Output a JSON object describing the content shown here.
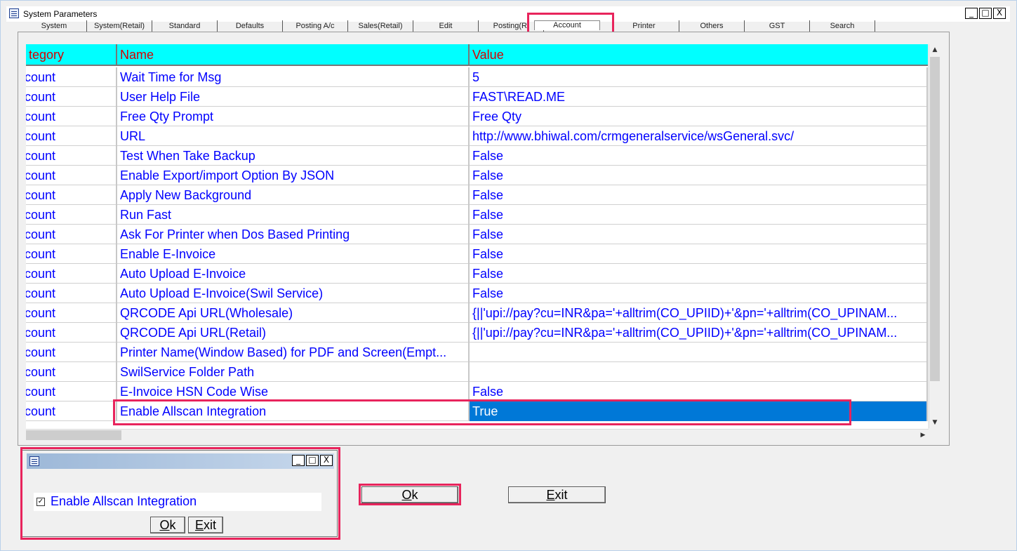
{
  "window": {
    "title": "System Parameters",
    "controls": [
      "_",
      "□",
      "X"
    ]
  },
  "tabs": [
    {
      "label": "System"
    },
    {
      "label": "System(Retail)"
    },
    {
      "label": "Standard"
    },
    {
      "label": "Defaults"
    },
    {
      "label": "Posting A/c"
    },
    {
      "label": "Sales(Retail)"
    },
    {
      "label": "Edit"
    },
    {
      "label": "Posting(Ri"
    },
    {
      "label": "Account"
    },
    {
      "label": "Printer"
    },
    {
      "label": "Others"
    },
    {
      "label": "GST"
    },
    {
      "label": "Search"
    }
  ],
  "grid": {
    "headers": {
      "category": "tegory",
      "name": "Name",
      "value": "Value"
    },
    "rows": [
      {
        "category": "count",
        "name": "Wait Time for Msg",
        "value": "5"
      },
      {
        "category": "count",
        "name": "User Help File",
        "value": "FAST\\READ.ME"
      },
      {
        "category": "count",
        "name": "Free Qty Prompt",
        "value": "Free Qty"
      },
      {
        "category": "count",
        "name": "URL",
        "value": "http://www.bhiwal.com/crmgeneralservice/wsGeneral.svc/"
      },
      {
        "category": "count",
        "name": "Test When Take Backup",
        "value": "False"
      },
      {
        "category": "count",
        "name": "Enable Export/import Option By JSON",
        "value": "False"
      },
      {
        "category": "count",
        "name": "Apply New Background",
        "value": "False"
      },
      {
        "category": "count",
        "name": "Run Fast",
        "value": "False"
      },
      {
        "category": "count",
        "name": "Ask For Printer when Dos Based Printing",
        "value": "False"
      },
      {
        "category": "count",
        "name": "Enable E-Invoice",
        "value": "False"
      },
      {
        "category": "count",
        "name": "Auto Upload E-Invoice",
        "value": "False"
      },
      {
        "category": "count",
        "name": "Auto Upload E-Invoice(Swil Service)",
        "value": "False"
      },
      {
        "category": "count",
        "name": "QRCODE Api URL(Wholesale)",
        "value": "{||'upi://pay?cu=INR&pa='+alltrim(CO_UPIID)+'&pn='+alltrim(CO_UPINAM..."
      },
      {
        "category": "count",
        "name": "QRCODE Api URL(Retail)",
        "value": "{||'upi://pay?cu=INR&pa='+alltrim(CO_UPIID)+'&pn='+alltrim(CO_UPINAM..."
      },
      {
        "category": "count",
        "name": "Printer Name(Window Based) for PDF and Screen(Empt...",
        "value": ""
      },
      {
        "category": "count",
        "name": "SwilService Folder Path",
        "value": ""
      },
      {
        "category": "count",
        "name": "E-Invoice HSN Code Wise",
        "value": "False"
      },
      {
        "category": "count",
        "name": "Enable Allscan Integration",
        "value": "True"
      }
    ]
  },
  "buttons": {
    "ok_first": "O",
    "ok_rest": "k",
    "exit_first": "E",
    "exit_rest": "xit"
  },
  "dialog": {
    "controls": [
      "_",
      "□",
      "X"
    ],
    "checkbox_label": "Enable Allscan Integration",
    "checkbox_mark": "✓",
    "ok_first": "O",
    "ok_rest": "k",
    "exit_first": "E",
    "exit_rest": "xit"
  },
  "colors": {
    "header_bg": "#00ffff",
    "header_text": "#d80000",
    "cell_text": "#0000ff",
    "selection": "#0078d7",
    "highlight": "#e8245c"
  }
}
